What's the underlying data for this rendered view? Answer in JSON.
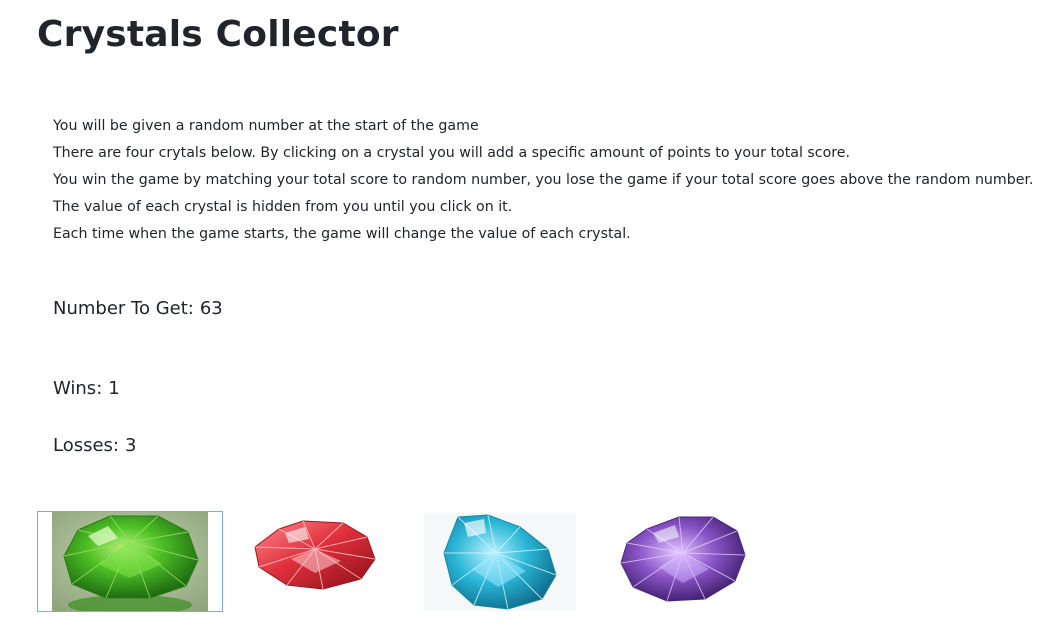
{
  "page": {
    "title": "Crystals Collector"
  },
  "instructions": [
    "You will be given a random number at the start of the game",
    "There are four crytals below. By clicking on a crystal you will add a specific amount of points to your total score.",
    "You win the game by matching your total score to random number, you lose the game if your total score goes above the random number.",
    "The value of each crystal is hidden from you until you click on it.",
    "Each time when the game starts, the game will change the value of each crystal."
  ],
  "stats": {
    "target_label": "Number To Get:",
    "target_value": "63",
    "wins_label": "Wins:",
    "wins_value": "1",
    "losses_label": "Losses:",
    "losses_value": "3"
  },
  "crystals": [
    {
      "name": "green",
      "color": "#3fae1f"
    },
    {
      "name": "red",
      "color": "#e0303c"
    },
    {
      "name": "blue",
      "color": "#2ab6d6"
    },
    {
      "name": "purple",
      "color": "#8a55c7"
    }
  ],
  "colors": {
    "text": "#212529",
    "focus_border": "#7ea9e8"
  }
}
